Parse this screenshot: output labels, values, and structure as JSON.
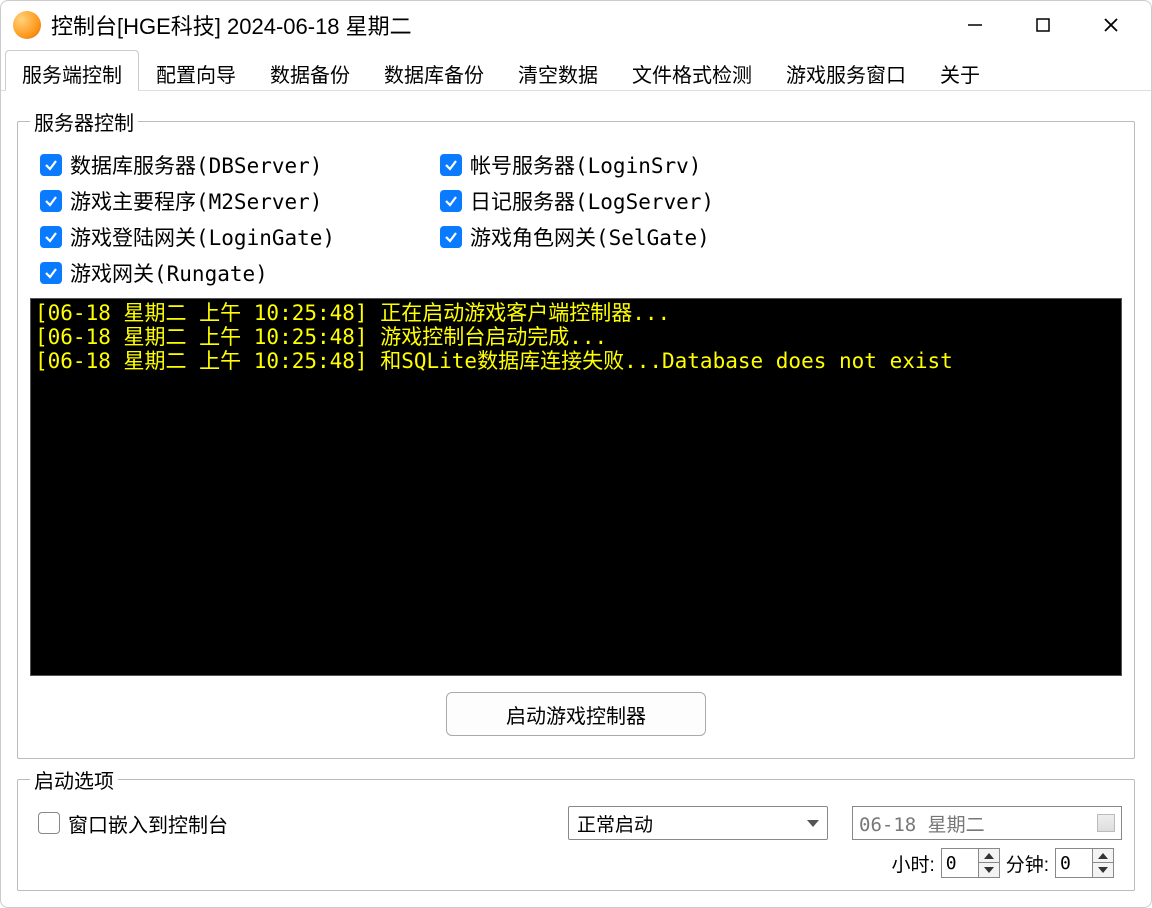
{
  "window": {
    "title": "控制台[HGE科技] 2024-06-18 星期二"
  },
  "tabs": [
    "服务端控制",
    "配置向导",
    "数据备份",
    "数据库备份",
    "清空数据",
    "文件格式检测",
    "游戏服务窗口",
    "关于"
  ],
  "server_control": {
    "legend": "服务器控制",
    "left": [
      "数据库服务器(DBServer)",
      "游戏主要程序(M2Server)",
      "游戏登陆网关(LoginGate)",
      "游戏网关(Rungate)"
    ],
    "right": [
      "帐号服务器(LoginSrv)",
      "日记服务器(LogServer)",
      "游戏角色网关(SelGate)"
    ]
  },
  "log_lines": [
    "[06-18 星期二 上午 10:25:48] 正在启动游戏客户端控制器...",
    "[06-18 星期二 上午 10:25:48] 游戏控制台启动完成...",
    "[06-18 星期二 上午 10:25:48] 和SQLite数据库连接失败...Database does not exist"
  ],
  "main_button": "启动游戏控制器",
  "startup": {
    "legend": "启动选项",
    "embed_label": "窗口嵌入到控制台",
    "mode_selected": "正常启动",
    "date_value": "06-18 星期二",
    "hour_label": "小时:",
    "hour_value": "0",
    "minute_label": "分钟:",
    "minute_value": "0"
  }
}
